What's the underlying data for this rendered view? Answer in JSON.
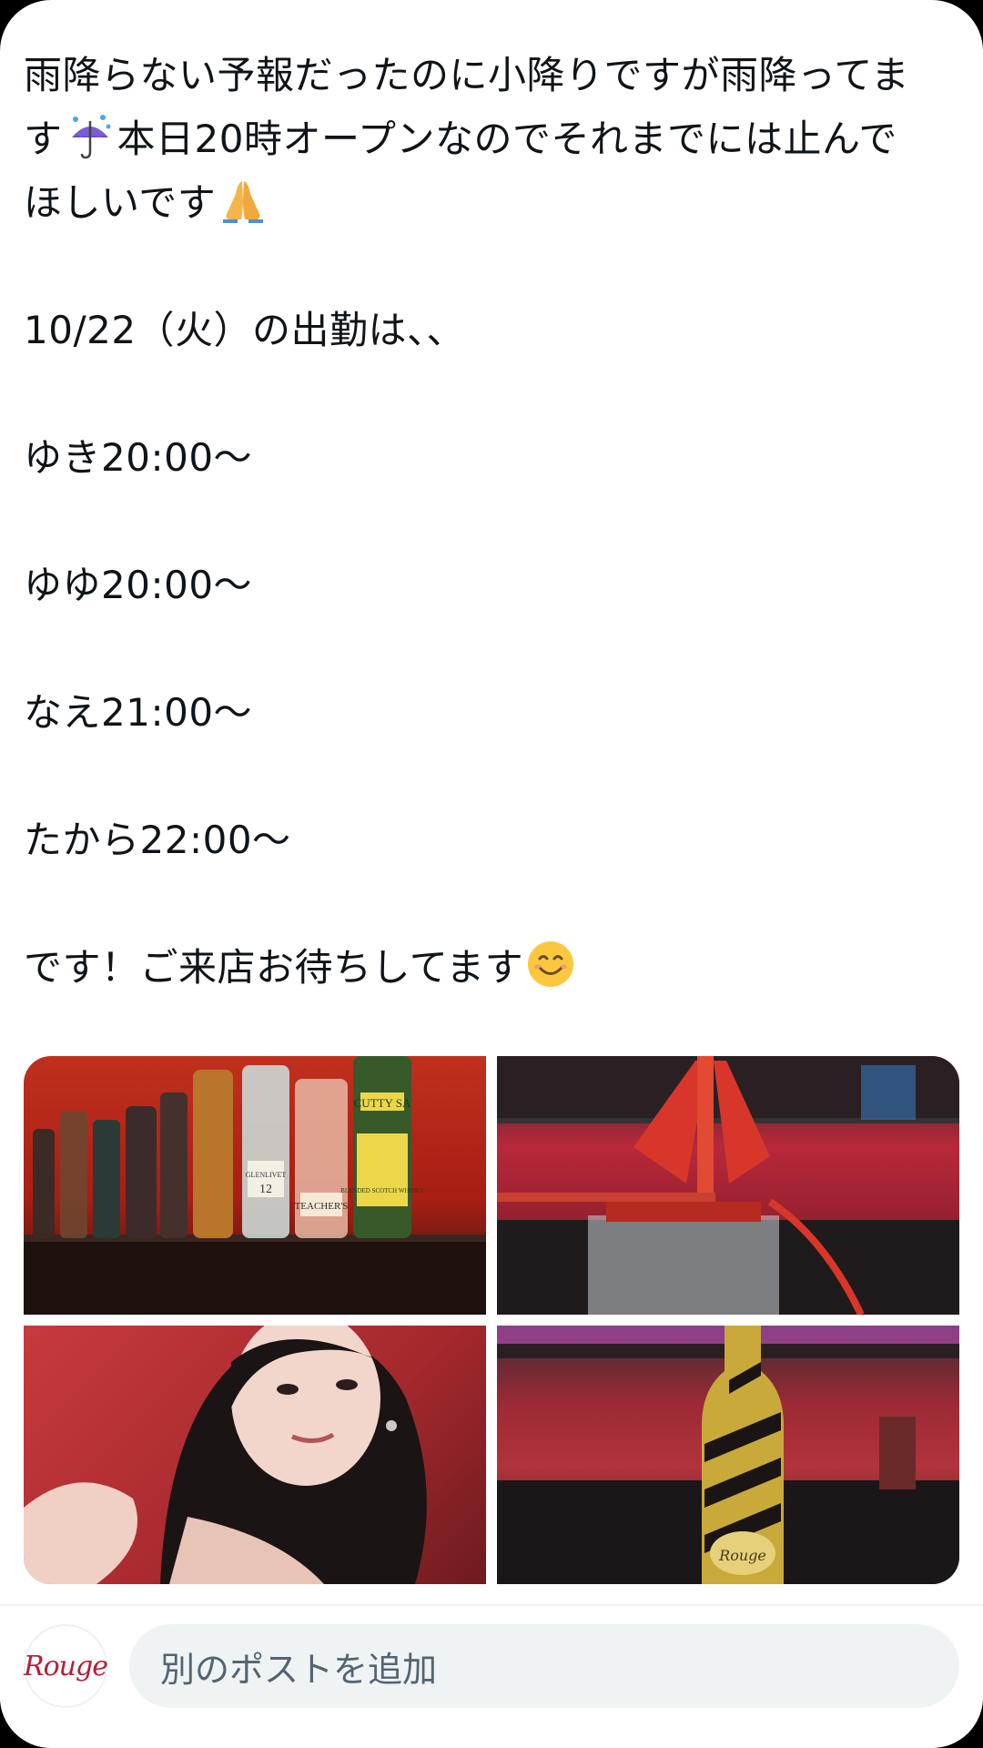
{
  "post": {
    "lines": [
      "雨降らない予報だったのに小降りですが雨降ってま",
      "本日20時オープンなのでそれまでには止んで",
      "ほしいです"
    ],
    "line2_prefix": "す",
    "schedule_heading": "10/22（火）の出勤は、、",
    "shifts": [
      "ゆき20:00〜",
      "ゆゆ20:00〜",
      "なえ21:00〜",
      "たから22:00〜"
    ],
    "closing": "です！ご来店お待ちしてます"
  },
  "media": {
    "images": [
      {
        "name": "bar-bottles-photo",
        "label_cutty": "CUTTY SA",
        "label_teachers": "TEACHER'S",
        "label_glenlivet": "GLENLIVET",
        "label_blended": "BLENDED SCOTCH WHISKY",
        "age": "12"
      },
      {
        "name": "hookah-bar-photo"
      },
      {
        "name": "staff-selfie-photo"
      },
      {
        "name": "champagne-bottle-photo",
        "bottle_label": "Rouge"
      }
    ]
  },
  "composer": {
    "avatar_text": "Rouge",
    "placeholder": "別のポストを追加"
  },
  "icons": {
    "rain": "umbrella-with-rain-icon",
    "pray": "folded-hands-icon",
    "smile": "smiling-face-icon"
  }
}
